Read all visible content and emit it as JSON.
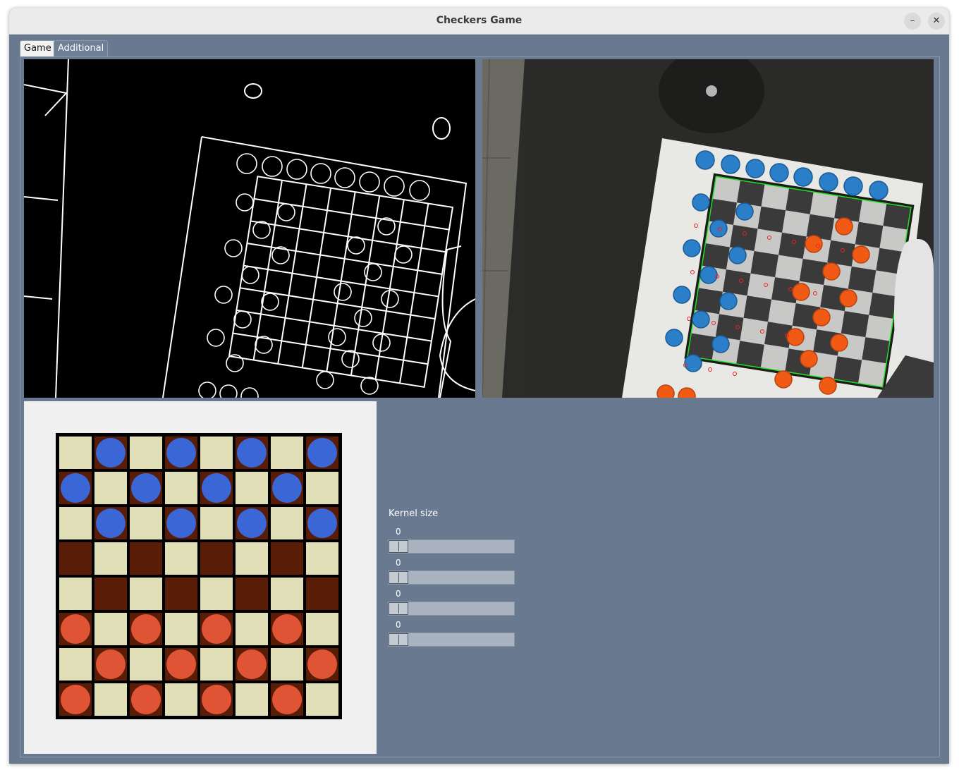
{
  "window": {
    "title": "Checkers Game",
    "minimize_icon": "minimize-icon",
    "close_icon": "close-icon",
    "minimize_glyph": "–",
    "close_glyph": "✕"
  },
  "tabs": [
    {
      "label": "Game",
      "active": true
    },
    {
      "label": "Additional views",
      "active": false
    }
  ],
  "board": {
    "rows": 8,
    "cols": 8,
    "colors": {
      "light": "#e0dfb8",
      "dark": "#581c07",
      "blue": "#3b66d6",
      "red": "#df5435",
      "border": "#000000"
    },
    "pieces": [
      [
        "",
        "B",
        "",
        "B",
        "",
        "B",
        "",
        "B"
      ],
      [
        "B",
        "",
        "B",
        "",
        "B",
        "",
        "B",
        ""
      ],
      [
        "",
        "B",
        "",
        "B",
        "",
        "B",
        "",
        "B"
      ],
      [
        "",
        "",
        "",
        "",
        "",
        "",
        "",
        ""
      ],
      [
        "",
        "",
        "",
        "",
        "",
        "",
        "",
        ""
      ],
      [
        "R",
        "",
        "R",
        "",
        "R",
        "",
        "R",
        ""
      ],
      [
        "",
        "R",
        "",
        "R",
        "",
        "R",
        "",
        "R"
      ],
      [
        "R",
        "",
        "R",
        "",
        "R",
        "",
        "R",
        ""
      ]
    ]
  },
  "controls": {
    "kernel_label": "Kernel size",
    "sliders": [
      {
        "value": "0"
      },
      {
        "value": "0"
      },
      {
        "value": "0"
      },
      {
        "value": "0"
      }
    ]
  },
  "views": {
    "edge_view": "edge-detection-view",
    "camera_view": "camera-detection-view"
  }
}
